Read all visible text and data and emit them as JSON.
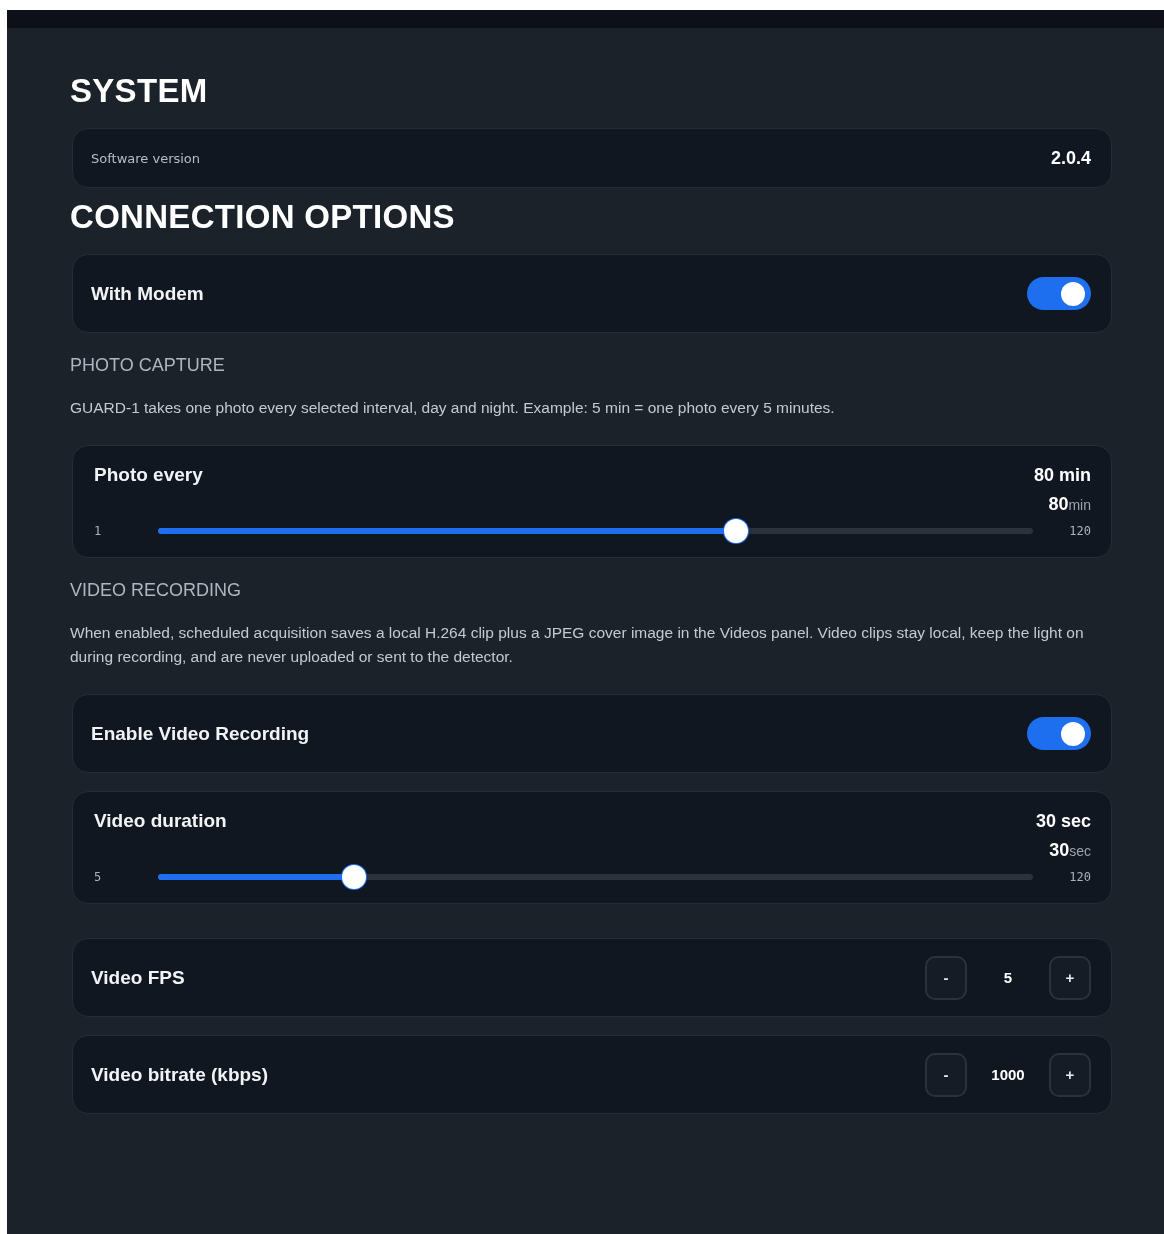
{
  "items": [
    {
      "kind": "heading",
      "text": "SYSTEM"
    },
    {
      "kind": "info",
      "label": "Software version",
      "value": "2.0.4"
    },
    {
      "kind": "heading",
      "text": "CONNECTION OPTIONS"
    },
    {
      "kind": "toggle",
      "label": "With Modem",
      "on": true
    },
    {
      "kind": "subheading",
      "text": "PHOTO CAPTURE"
    },
    {
      "kind": "paragraph",
      "text": "GUARD-1 takes one photo every selected interval, day and night. Example: 5 min = one photo every 5 minutes."
    },
    {
      "kind": "slider",
      "label": "Photo every",
      "reading": "80 min",
      "value": "80",
      "unit": "min",
      "min": "1",
      "max": "120",
      "level": 0.66
    },
    {
      "kind": "subheading",
      "text": "VIDEO RECORDING"
    },
    {
      "kind": "paragraph",
      "text": "When enabled, scheduled acquisition saves a local H.264 clip plus a JPEG cover image in the Videos panel. Video clips stay local, keep the light on during recording, and are never uploaded or sent to the detector."
    },
    {
      "kind": "toggle",
      "label": "Enable Video Recording",
      "on": true
    },
    {
      "kind": "slider",
      "label": "Video duration",
      "reading": "30 sec",
      "value": "30",
      "unit": "sec",
      "min": "5",
      "max": "120",
      "level": 0.224
    },
    {
      "kind": "stepper",
      "label": "Video FPS",
      "minus": "-",
      "value": "5",
      "plus": "+"
    },
    {
      "kind": "stepper",
      "label": "Video bitrate (kbps)",
      "minus": "-",
      "value": "1000",
      "plus": "+"
    }
  ]
}
